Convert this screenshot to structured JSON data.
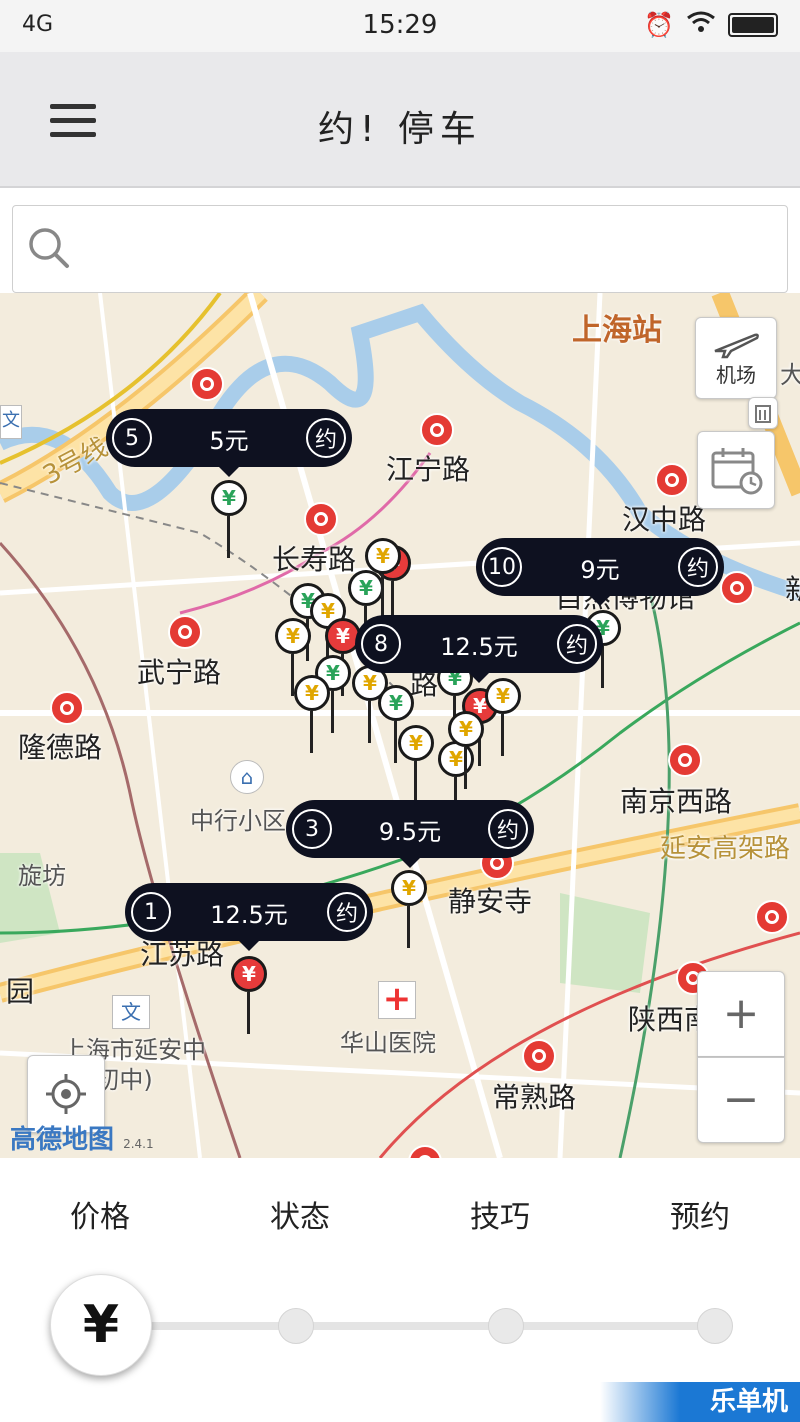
{
  "status_bar": {
    "network": "4G",
    "time": "15:29",
    "icons": [
      "alarm-icon",
      "wifi-icon",
      "battery-icon"
    ]
  },
  "header": {
    "title": "约! 停车",
    "menu_icon": "hamburger-menu-icon"
  },
  "search": {
    "placeholder": "",
    "value": "",
    "icon": "search-icon"
  },
  "map": {
    "labels": [
      {
        "text": "上海站",
        "style": "orange"
      },
      {
        "text": "江宁路",
        "style": "normal"
      },
      {
        "text": "汉中路",
        "style": "normal"
      },
      {
        "text": "长寿路",
        "style": "normal"
      },
      {
        "text": "武宁路",
        "style": "normal"
      },
      {
        "text": "隆德路",
        "style": "normal"
      },
      {
        "text": "南京西路",
        "style": "normal"
      },
      {
        "text": "延安高架路",
        "style": "yellow"
      },
      {
        "text": "中行小区",
        "style": "small"
      },
      {
        "text": "静安寺",
        "style": "normal"
      },
      {
        "text": "江苏路",
        "style": "normal"
      },
      {
        "text": "旋坊",
        "style": "small"
      },
      {
        "text": "园",
        "style": "normal"
      },
      {
        "text": "华山医院",
        "style": "small"
      },
      {
        "text": "上海市延安中学(初中)",
        "style": "small"
      },
      {
        "text": "陕西南路",
        "style": "normal"
      },
      {
        "text": "常熟路",
        "style": "normal"
      },
      {
        "text": "自然博物馆",
        "style": "normal"
      },
      {
        "text": "3号线",
        "style": "yellow"
      },
      {
        "text": "大",
        "style": "small"
      },
      {
        "text": "路",
        "style": "normal"
      },
      {
        "text": "新",
        "style": "normal"
      }
    ],
    "bubbles": [
      {
        "count": "5",
        "price": "5元",
        "action": "约"
      },
      {
        "count": "10",
        "price": "9元",
        "action": "约"
      },
      {
        "count": "8",
        "price": "12.5元",
        "action": "约"
      },
      {
        "count": "3",
        "price": "9.5元",
        "action": "约"
      },
      {
        "count": "1",
        "price": "12.5元",
        "action": "约"
      }
    ],
    "pin_symbol": "¥",
    "airport_button": {
      "label": "机场",
      "icon": "airplane-icon"
    },
    "calendar_button": {
      "icon": "calendar-clock-icon"
    },
    "zoom_in": "+",
    "zoom_out": "−",
    "locate_icon": "crosshair-locate-icon",
    "logo": {
      "text": "高德地图",
      "version": "2.4.1"
    }
  },
  "tabs": [
    "价格",
    "状态",
    "技巧",
    "预约"
  ],
  "slider": {
    "knob_symbol": "¥",
    "steps": 4,
    "selected_index": 0
  },
  "watermark": "乐单机",
  "colors": {
    "bubble_bg": "#0e1120",
    "metro_red": "#e43a34",
    "pin_green": "#2aa35a",
    "pin_red": "#e63b3b",
    "pin_yellow": "#e0a600",
    "map_bg": "#f3ecdd"
  }
}
